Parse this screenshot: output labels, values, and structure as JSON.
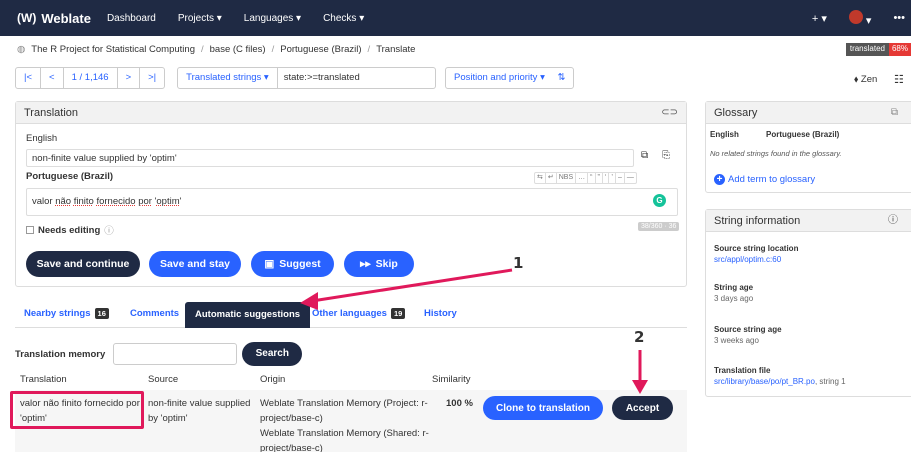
{
  "navbar": {
    "brand": "Weblate",
    "links": [
      "Dashboard",
      "Projects ▾",
      "Languages ▾",
      "Checks ▾"
    ],
    "add": "+ ▾",
    "more": "•••"
  },
  "breadcrumb": [
    "The R Project for Statistical Computing",
    "base (C files)",
    "Portuguese (Brazil)",
    "Translate"
  ],
  "status_badge": {
    "label": "translated",
    "value": "68%"
  },
  "toolbar": {
    "position": "1 / 1,146",
    "filter": "Translated strings ▾",
    "query": "state:>=translated",
    "sort": "Position and priority ▾",
    "zen": "Zen"
  },
  "translation": {
    "title": "Translation",
    "source_lang": "English",
    "source_text": "non-finite value supplied by 'optim'",
    "target_lang": "Portuguese (Brazil)",
    "target_text_parts": [
      "valor ",
      "não",
      " ",
      "finito",
      " ",
      "fornecido",
      " ",
      "por",
      " '",
      "optim",
      "'"
    ],
    "special_chars": [
      "⇆",
      "↵",
      "NBS",
      "…",
      "“",
      "”",
      "‘",
      "’",
      "–",
      "—"
    ],
    "needs_editing": "Needs editing",
    "counter": "38/360 · 36"
  },
  "actions": {
    "save_continue": "Save and continue",
    "save_stay": "Save and stay",
    "suggest": "Suggest",
    "skip": "Skip"
  },
  "tabs": {
    "nearby": "Nearby strings",
    "nearby_count": "16",
    "comments": "Comments",
    "auto": "Automatic suggestions",
    "other": "Other languages",
    "other_count": "19",
    "history": "History"
  },
  "tm": {
    "label": "Translation memory",
    "search": "Search"
  },
  "table": {
    "headers": [
      "Translation",
      "Source",
      "Origin",
      "Similarity"
    ],
    "row": {
      "translation_l1": "valor não finito fornecido por",
      "translation_l2": "'optim'",
      "source_l1": "non-finite value supplied",
      "source_l2": "by 'optim'",
      "origin_l1": "Weblate Translation Memory (Project: r-",
      "origin_l2": "project/base-c)",
      "origin_l3": "Weblate Translation Memory (Shared: r-",
      "origin_l4": "project/base-c)",
      "similarity": "100 %",
      "clone": "Clone to translation",
      "accept": "Accept"
    }
  },
  "glossary": {
    "title": "Glossary",
    "col_source": "English",
    "col_target": "Portuguese (Brazil)",
    "empty": "No related strings found in the glossary.",
    "add": "Add term to glossary"
  },
  "string_info": {
    "title": "String information",
    "location_label": "Source string location",
    "location_value": "src/appl/optim.c:60",
    "age_label": "String age",
    "age_value": "3 days ago",
    "source_age_label": "Source string age",
    "source_age_value": "3 weeks ago",
    "file_label": "Translation file",
    "file_value": "src/library/base/po/pt_BR.po",
    "file_suffix": ", string 1"
  },
  "annotations": {
    "one": "1",
    "two": "2"
  },
  "colors": {
    "navbar": "#1f2a44",
    "primary": "#2962ff",
    "highlight": "#e0195b"
  }
}
